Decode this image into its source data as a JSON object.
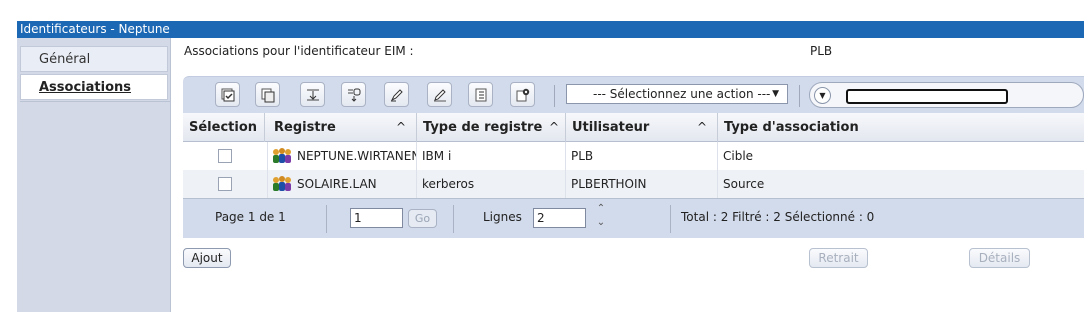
{
  "window": {
    "title": "Identificateurs - Neptune"
  },
  "sidebar": {
    "tabs": [
      {
        "label": "Général",
        "selected": false
      },
      {
        "label": "Associations",
        "selected": true
      }
    ]
  },
  "main": {
    "associations_label": "Associations pour l'identificateur EIM :",
    "identifier_value": "PLB"
  },
  "toolbar": {
    "icons": [
      "select-all-icon",
      "copy-icon",
      "expand-icon",
      "collapse-icon",
      "edit-icon",
      "rename-icon",
      "columns-icon",
      "configure-icon"
    ],
    "action_select": "--- Sélectionnez une action ---",
    "filter_value": ""
  },
  "table": {
    "columns": [
      "Sélection",
      "Registre",
      "Type de registre",
      "Utilisateur",
      "Type d'association"
    ],
    "sort_indicator": "^",
    "rows": [
      {
        "registre": "NEPTUNE.WIRTANEN",
        "type_registre": "IBM i",
        "utilisateur": "PLB",
        "type_association": "Cible",
        "checked": false
      },
      {
        "registre": "SOLAIRE.LAN",
        "type_registre": "kerberos",
        "utilisateur": "PLBERTHOIN",
        "type_association": "Source",
        "checked": false
      }
    ]
  },
  "pagination": {
    "page_text": "Page 1 de 1",
    "page_input": "1",
    "go_label": "Go",
    "lignes_label": "Lignes",
    "lignes_value": "2",
    "summary": "Total : 2  Filtré : 2  Sélectionné : 0"
  },
  "buttons": {
    "add": "Ajout",
    "remove": "Retrait",
    "details": "Détails"
  },
  "colors": {
    "titlebar": "#1d68b4",
    "sidebar": "#d3d9e6",
    "toolbar": "#d2dbeb"
  }
}
